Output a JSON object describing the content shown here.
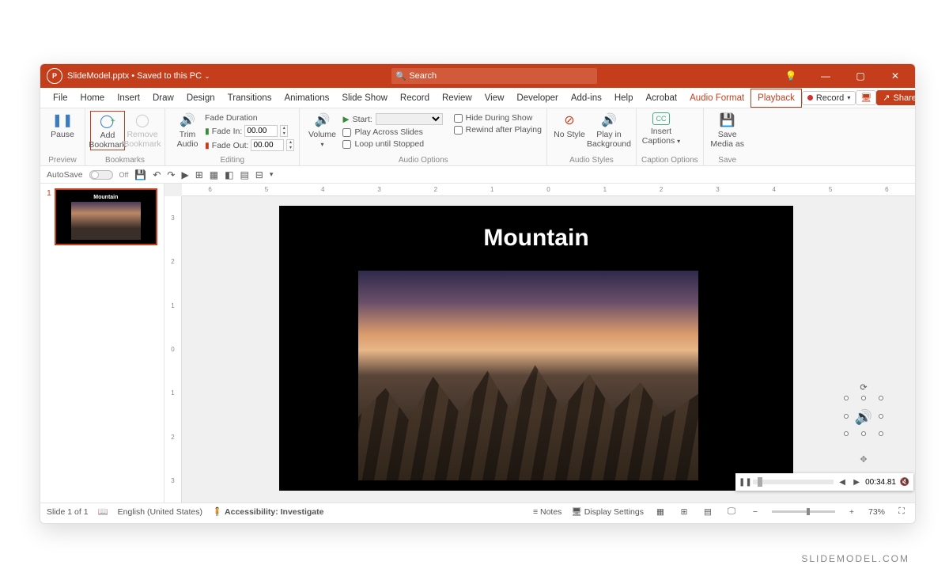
{
  "title": {
    "filename": "SlideModel.pptx",
    "status": "Saved to this PC"
  },
  "search": {
    "placeholder": "Search"
  },
  "tabs": [
    "File",
    "Home",
    "Insert",
    "Draw",
    "Design",
    "Transitions",
    "Animations",
    "Slide Show",
    "Record",
    "Review",
    "View",
    "Developer",
    "Add-ins",
    "Help",
    "Acrobat",
    "Audio Format",
    "Playback"
  ],
  "topright": {
    "record": "Record",
    "share": "Share"
  },
  "ribbon": {
    "preview": {
      "pause": "Pause",
      "label": "Preview"
    },
    "bookmarks": {
      "add": "Add Bookmark",
      "remove": "Remove Bookmark",
      "label": "Bookmarks"
    },
    "editing": {
      "trim": "Trim Audio",
      "fade_title": "Fade Duration",
      "fade_in_lbl": "Fade In:",
      "fade_in_val": "00.00",
      "fade_out_lbl": "Fade Out:",
      "fade_out_val": "00.00",
      "label": "Editing"
    },
    "audio_options": {
      "volume": "Volume",
      "start_lbl": "Start:",
      "play_across": "Play Across Slides",
      "loop": "Loop until Stopped",
      "hide": "Hide During Show",
      "rewind": "Rewind after Playing",
      "label": "Audio Options"
    },
    "styles": {
      "no_style": "No Style",
      "play_bg": "Play in Background",
      "label": "Audio Styles"
    },
    "captions": {
      "insert": "Insert Captions",
      "label": "Caption Options"
    },
    "save": {
      "save_media": "Save Media as",
      "label": "Save"
    }
  },
  "qat": {
    "autosave": "AutoSave",
    "off": "Off"
  },
  "thumb": {
    "num": "1",
    "title": "Mountain"
  },
  "slide": {
    "title": "Mountain"
  },
  "ruler_h": [
    "6",
    "5",
    "4",
    "3",
    "2",
    "1",
    "0",
    "1",
    "2",
    "3",
    "4",
    "5",
    "6"
  ],
  "ruler_v": [
    "3",
    "2",
    "1",
    "0",
    "1",
    "2",
    "3"
  ],
  "player": {
    "time": "00:34.81"
  },
  "status": {
    "slide": "Slide 1 of 1",
    "lang": "English (United States)",
    "access": "Accessibility: Investigate",
    "notes": "Notes",
    "display": "Display Settings",
    "zoom": "73%"
  },
  "watermark": "SLIDEMODEL.COM"
}
